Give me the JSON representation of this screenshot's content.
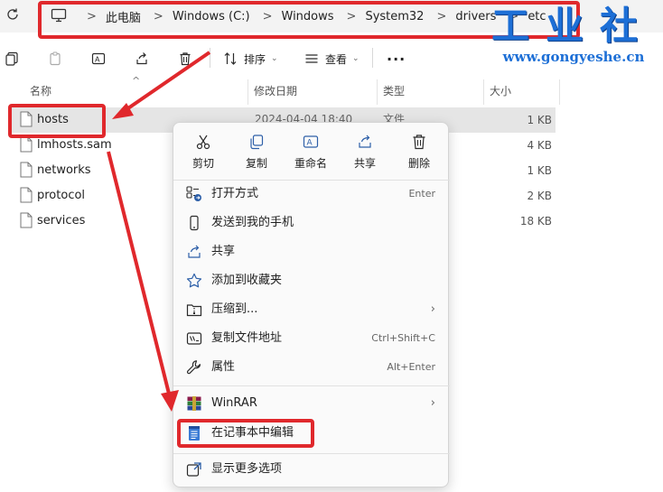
{
  "address_bar": {
    "crumbs": [
      "此电脑",
      "Windows (C:)",
      "Windows",
      "System32",
      "drivers",
      "etc"
    ],
    "separator": ">"
  },
  "watermark": {
    "title": "工业社",
    "url": "www.gongyeshe.cn"
  },
  "toolbar": {
    "sort_label": "排序",
    "view_label": "查看",
    "more_label": "···"
  },
  "columns": {
    "name": "名称",
    "modified": "修改日期",
    "type": "类型",
    "size": "大小"
  },
  "files": [
    {
      "name": "hosts",
      "modified": "2024-04-04 18:40",
      "type": "文件",
      "size": "1 KB"
    },
    {
      "name": "lmhosts.sam",
      "modified": "",
      "type": "",
      "size": "4 KB"
    },
    {
      "name": "networks",
      "modified": "",
      "type": "",
      "size": "1 KB"
    },
    {
      "name": "protocol",
      "modified": "",
      "type": "",
      "size": "2 KB"
    },
    {
      "name": "services",
      "modified": "",
      "type": "",
      "size": "18 KB"
    }
  ],
  "context_menu": {
    "quick_actions": [
      {
        "label": "剪切",
        "icon": "scissors-icon"
      },
      {
        "label": "复制",
        "icon": "copy-icon"
      },
      {
        "label": "重命名",
        "icon": "rename-icon"
      },
      {
        "label": "共享",
        "icon": "share-icon"
      },
      {
        "label": "删除",
        "icon": "trash-icon"
      }
    ],
    "items": [
      {
        "label": "打开方式",
        "shortcut": "Enter",
        "icon": "open-with-icon"
      },
      {
        "label": "发送到我的手机",
        "shortcut": "",
        "icon": "phone-icon"
      },
      {
        "label": "共享",
        "shortcut": "",
        "icon": "share-icon"
      },
      {
        "label": "添加到收藏夹",
        "shortcut": "",
        "icon": "star-icon"
      },
      {
        "label": "压缩到...",
        "shortcut": "",
        "icon": "zip-folder-icon",
        "submenu": true
      },
      {
        "label": "复制文件地址",
        "shortcut": "Ctrl+Shift+C",
        "icon": "copy-path-icon"
      },
      {
        "label": "属性",
        "shortcut": "Alt+Enter",
        "icon": "wrench-icon"
      },
      {
        "label": "WinRAR",
        "shortcut": "",
        "icon": "winrar-icon",
        "submenu": true
      },
      {
        "label": "在记事本中编辑",
        "shortcut": "",
        "icon": "notepad-icon"
      },
      {
        "label": "显示更多选项",
        "shortcut": "",
        "icon": "more-options-icon"
      }
    ],
    "submenu_chevron": "›"
  },
  "colors": {
    "highlight": "#e0282c",
    "accent": "#2d5fa8",
    "watermark": "#1d6fd6"
  }
}
